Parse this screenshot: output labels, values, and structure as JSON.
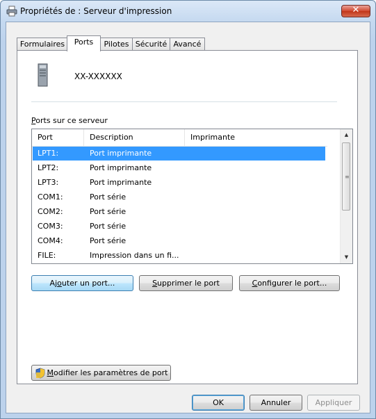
{
  "window": {
    "title": "Propriétés de : Serveur d'impression",
    "close_label": "✕"
  },
  "tabs": [
    {
      "label": "Formulaires",
      "active": false
    },
    {
      "label": "Ports",
      "active": true
    },
    {
      "label": "Pilotes",
      "active": false
    },
    {
      "label": "Sécurité",
      "active": false
    },
    {
      "label": "Avancé",
      "active": false
    }
  ],
  "server": {
    "name": "XX-XXXXXX"
  },
  "ports_section": {
    "label_first": "P",
    "label_rest": "orts sur ce serveur",
    "columns": [
      "Port",
      "Description",
      "Imprimante"
    ],
    "rows": [
      {
        "port": "LPT1:",
        "description": "Port imprimante",
        "selected": true
      },
      {
        "port": "LPT2:",
        "description": "Port imprimante",
        "selected": false
      },
      {
        "port": "LPT3:",
        "description": "Port imprimante",
        "selected": false
      },
      {
        "port": "COM1:",
        "description": "Port série",
        "selected": false
      },
      {
        "port": "COM2:",
        "description": "Port série",
        "selected": false
      },
      {
        "port": "COM3:",
        "description": "Port série",
        "selected": false
      },
      {
        "port": "COM4:",
        "description": "Port série",
        "selected": false
      },
      {
        "port": "FILE:",
        "description": "Impression dans un fi...",
        "selected": false
      }
    ]
  },
  "buttons": {
    "add_pre": "Aj",
    "add_u": "o",
    "add_post": "uter un port...",
    "delete_u": "S",
    "delete_post": "upprimer le port",
    "configure_u": "C",
    "configure_post": "onfigurer le port...",
    "modify_u": "M",
    "modify_post": "odifier les paramètres de port",
    "ok": "OK",
    "cancel": "Annuler",
    "apply": "Appliquer"
  },
  "colors": {
    "selection": "#3399ff",
    "close_button": "#c13519",
    "focus_button": "#bee6fd"
  }
}
